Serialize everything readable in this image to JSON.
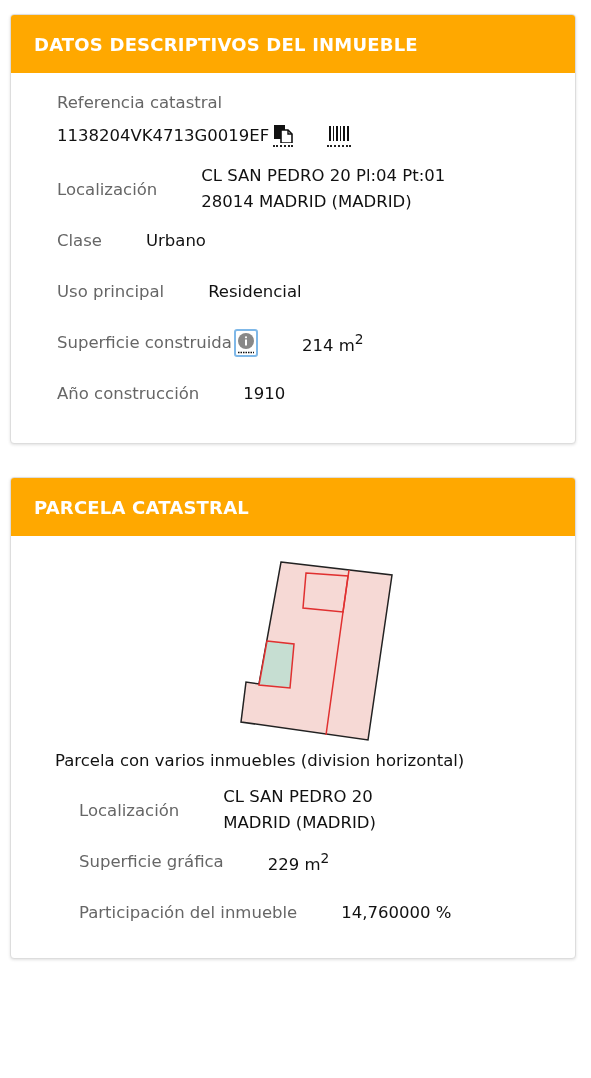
{
  "sections": [
    {
      "title": "DATOS DESCRIPTIVOS DEL INMUEBLE",
      "reference": {
        "label": "Referencia catastral",
        "value": "1138204VK4713G0019EF"
      },
      "rows": [
        {
          "kind": "plain",
          "label": "Localización",
          "lines": [
            "CL SAN PEDRO 20 Pl:04 Pt:01",
            "28014 MADRID (MADRID)"
          ]
        },
        {
          "kind": "plain",
          "label": "Clase",
          "lines": [
            "Urbano"
          ]
        },
        {
          "kind": "plain",
          "label": "Uso principal",
          "lines": [
            "Residencial"
          ]
        },
        {
          "kind": "info",
          "label": "Superficie construida",
          "lines": [
            "214 m$^{2}$"
          ]
        },
        {
          "kind": "plain",
          "label": "Año construcción",
          "lines": [
            "1910"
          ]
        }
      ]
    },
    {
      "title": "PARCELA CATASTRAL",
      "plot": {
        "kind": "parcel"
      },
      "description": "Parcela con varios inmuebles (division horizontal)",
      "rows": [
        {
          "kind": "plain",
          "label": "Localización",
          "lines": [
            "CL SAN PEDRO 20",
            "MADRID (MADRID)"
          ]
        },
        {
          "kind": "plain",
          "label": "Superficie gráfica",
          "lines": [
            "229 m$^{2}$"
          ]
        },
        {
          "kind": "plain",
          "label": "Participación del inmueble",
          "lines": [
            "14,760000 %"
          ]
        }
      ]
    }
  ]
}
